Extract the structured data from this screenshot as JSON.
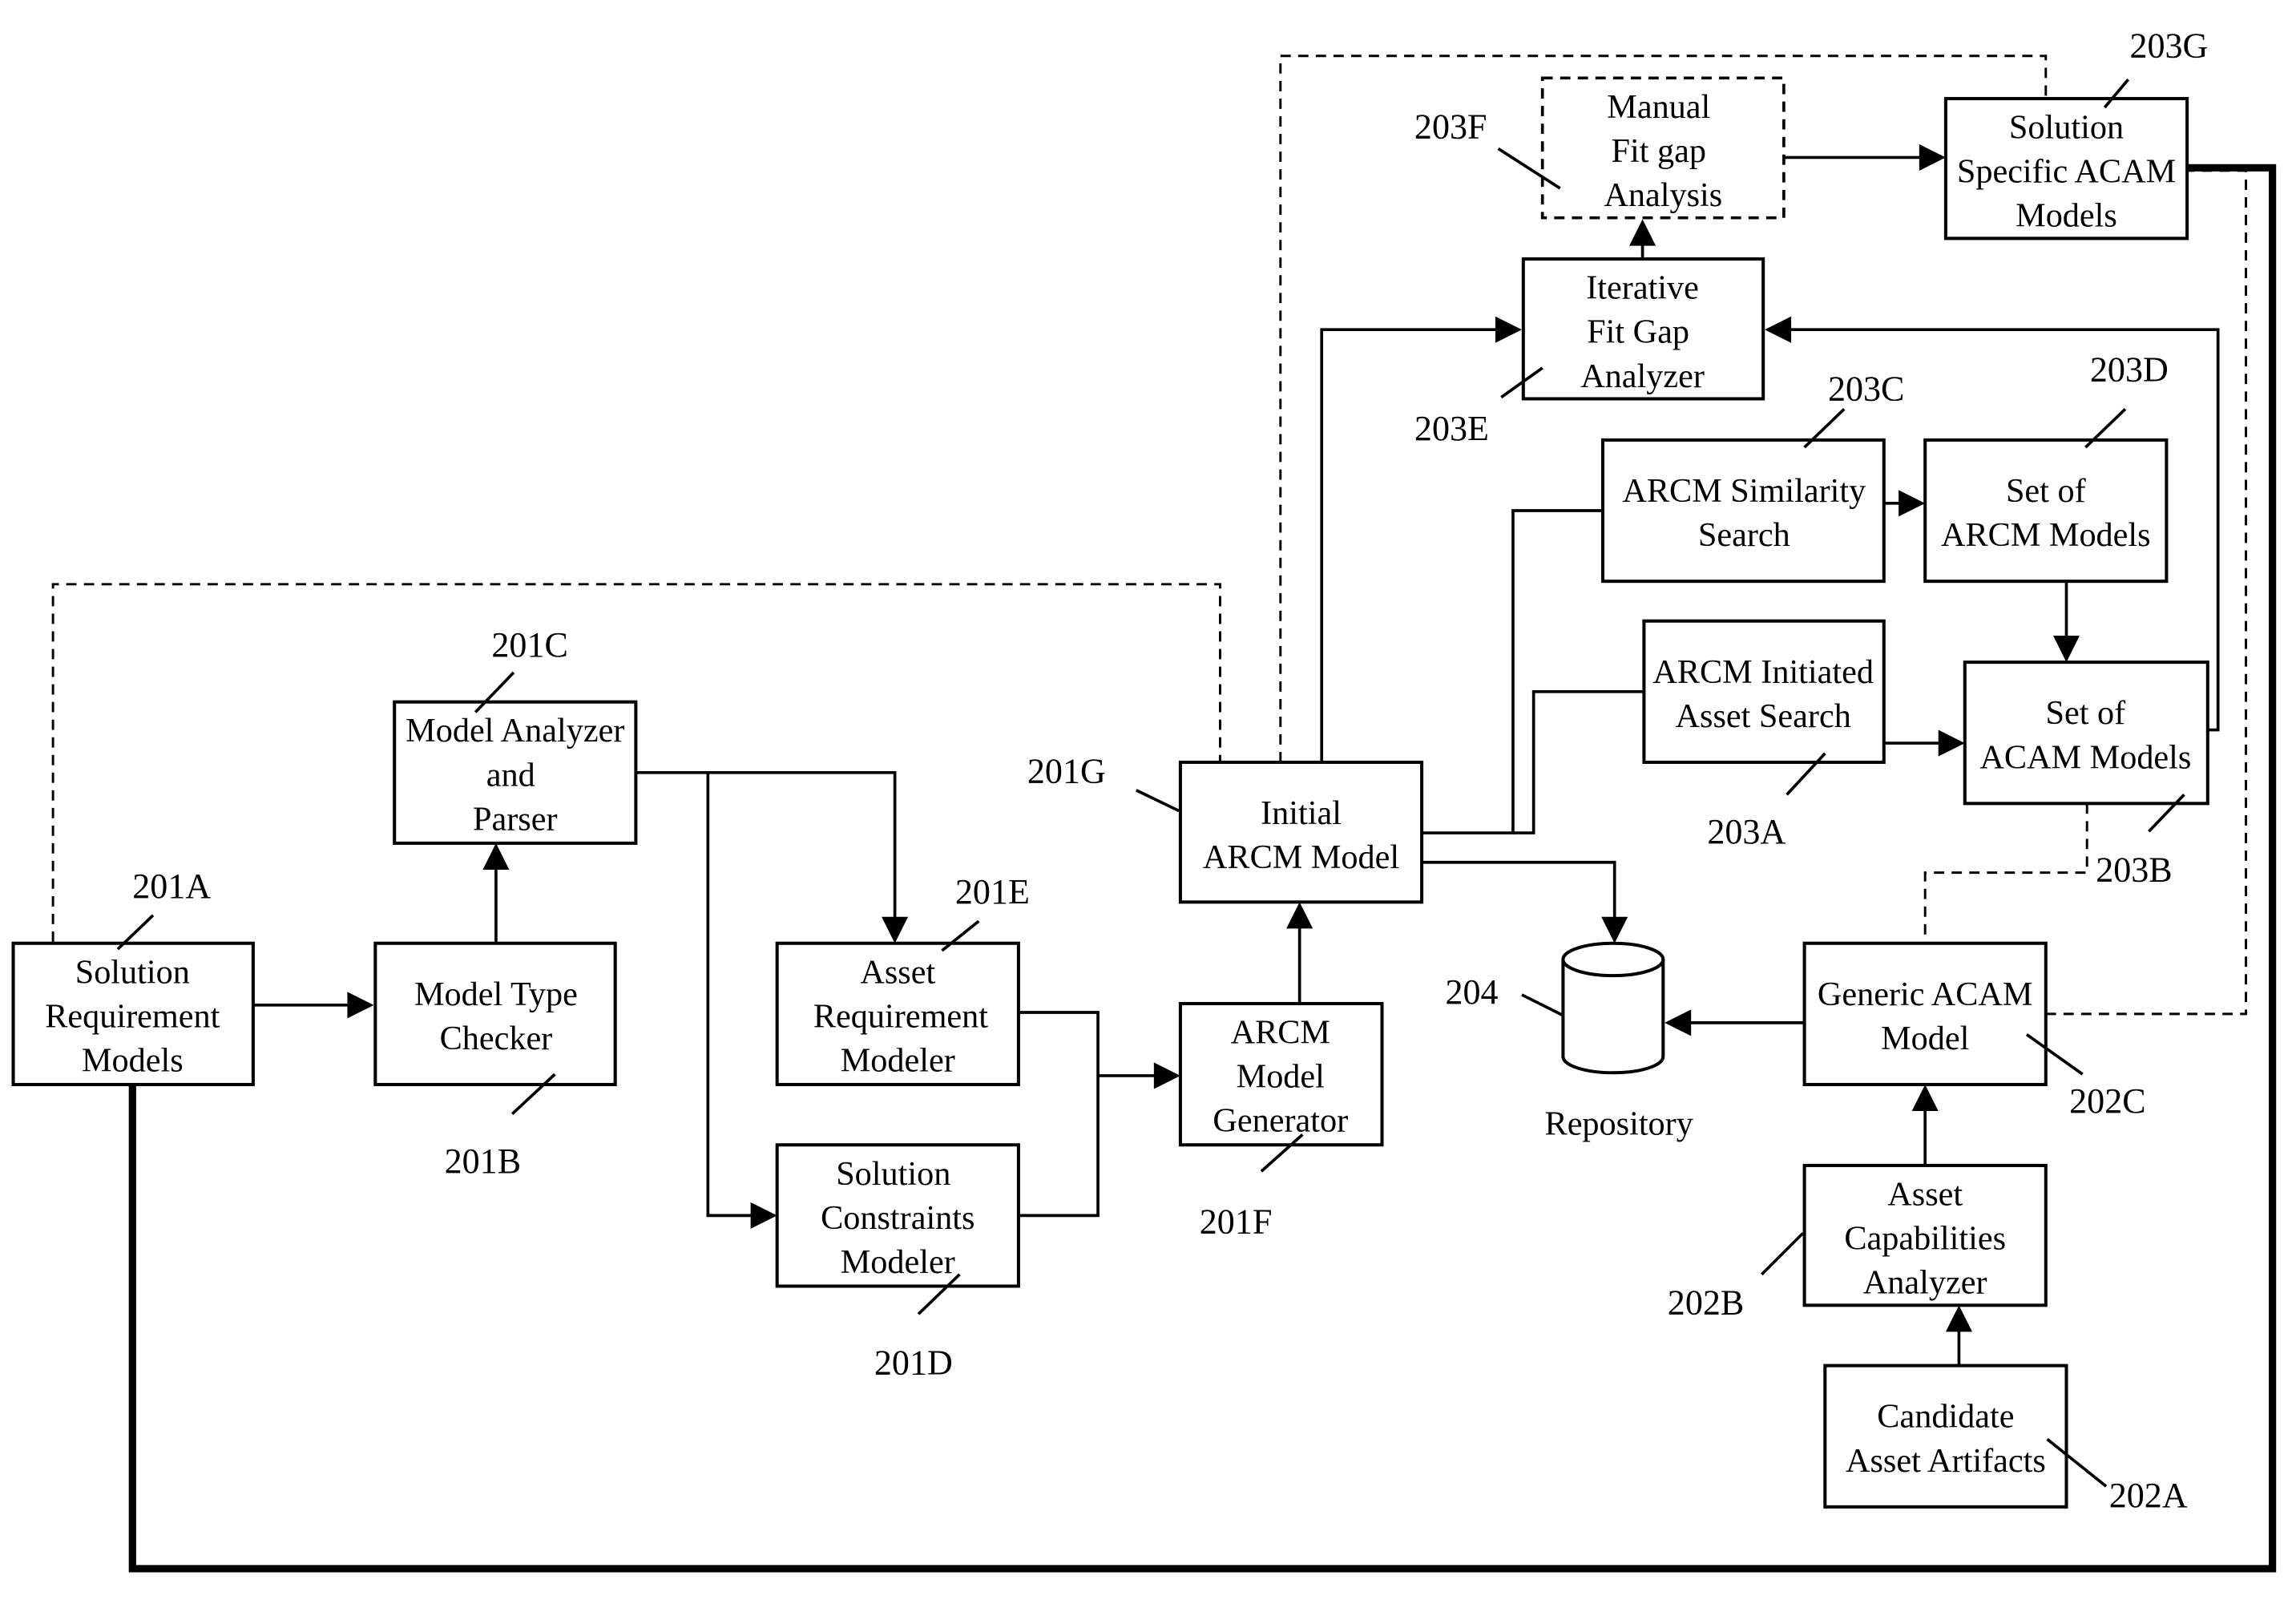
{
  "diagram": {
    "nodes": [
      {
        "id": "201A",
        "lines": [
          "Solution",
          "Requirement",
          "Models"
        ]
      },
      {
        "id": "201B",
        "lines": [
          "Model Type",
          "Checker"
        ]
      },
      {
        "id": "201C",
        "lines": [
          "Model Analyzer",
          "and",
          "Parser"
        ]
      },
      {
        "id": "201E",
        "lines": [
          "Asset",
          "Requirement",
          "Modeler"
        ]
      },
      {
        "id": "201D",
        "lines": [
          "Solution",
          "Constraints",
          "Modeler"
        ]
      },
      {
        "id": "201F",
        "lines": [
          "ARCM",
          "Model",
          "Generator"
        ]
      },
      {
        "id": "201G",
        "lines": [
          "Initial",
          "ARCM Model"
        ]
      },
      {
        "id": "203E",
        "lines": [
          "Iterative",
          "Fit Gap",
          "Analyzer"
        ]
      },
      {
        "id": "203F",
        "lines": [
          "Manual",
          "Fit gap",
          "Analysis"
        ]
      },
      {
        "id": "203G",
        "lines": [
          "Solution",
          "Specific  ACAM",
          "Models"
        ]
      },
      {
        "id": "203C",
        "lines": [
          "ARCM Similarity",
          "Search"
        ]
      },
      {
        "id": "203D",
        "lines": [
          "Set of",
          "ARCM Models"
        ]
      },
      {
        "id": "203A",
        "lines": [
          "ARCM Initiated",
          "Asset Search"
        ]
      },
      {
        "id": "203B",
        "lines": [
          "Set of",
          "ACAM Models"
        ]
      },
      {
        "id": "202C",
        "lines": [
          "Generic  ACAM",
          "Model"
        ]
      },
      {
        "id": "202B",
        "lines": [
          "Asset",
          "Capabilities",
          "Analyzer"
        ]
      },
      {
        "id": "202A",
        "lines": [
          "Candidate",
          "Asset Artifacts"
        ]
      }
    ],
    "repository": {
      "id": "204",
      "label": "Repository"
    },
    "ref_labels": [
      "201A",
      "201B",
      "201C",
      "201D",
      "201E",
      "201F",
      "201G",
      "202A",
      "202B",
      "202C",
      "203A",
      "203B",
      "203C",
      "203D",
      "203E",
      "203F",
      "203G",
      "204"
    ]
  }
}
